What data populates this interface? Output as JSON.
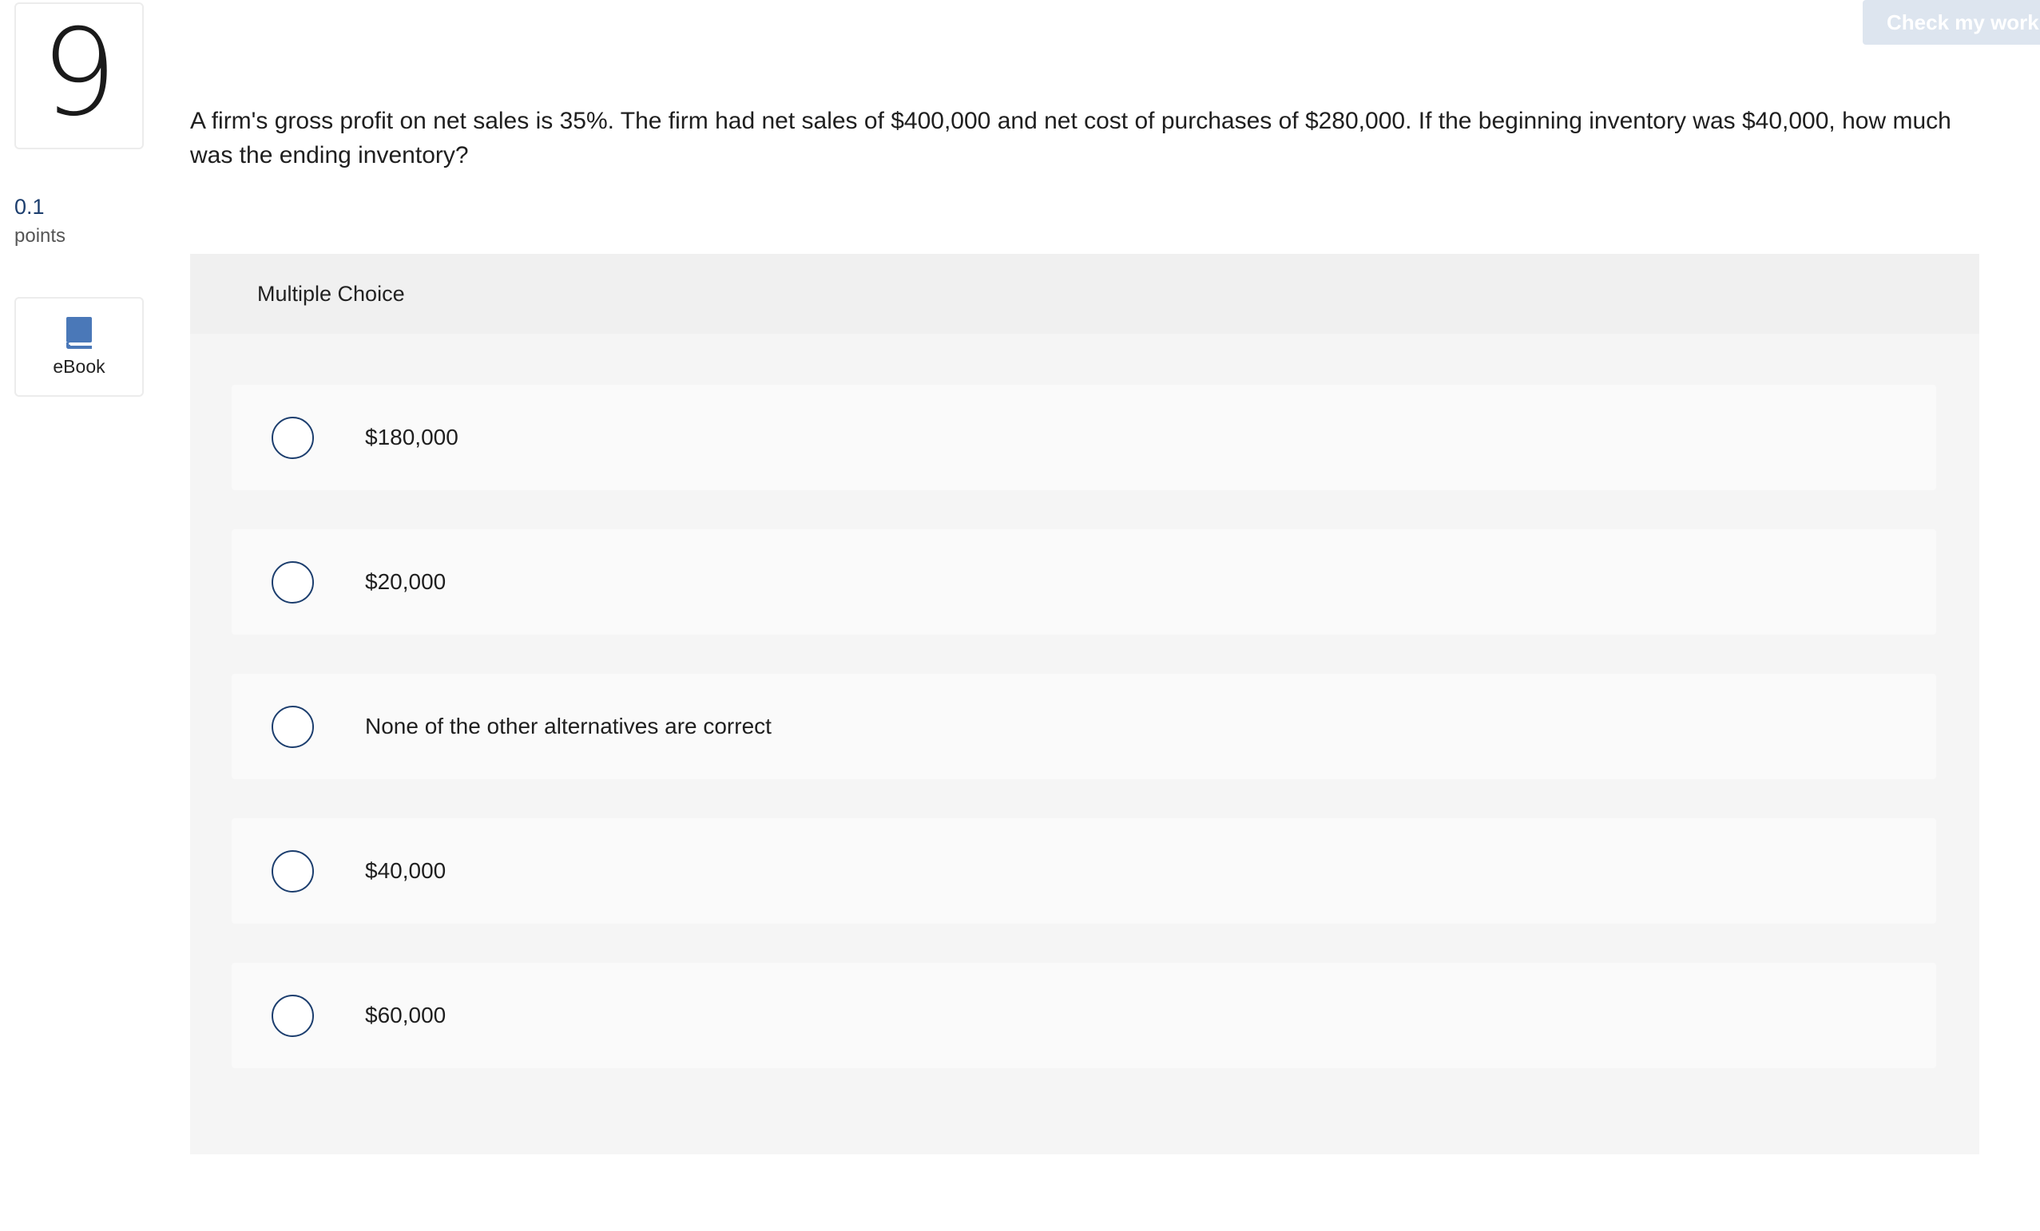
{
  "question_number": "9",
  "points": {
    "value": "0.1",
    "label": "points"
  },
  "ebook": {
    "label": "eBook",
    "icon": "book-icon"
  },
  "check_button": {
    "label": "Check my work"
  },
  "question_text": "A firm's gross profit on net sales is 35%. The firm had net sales of $400,000 and net cost of purchases of $280,000. If the beginning inventory was $40,000, how much was the ending inventory?",
  "answer_section": {
    "type_label": "Multiple Choice",
    "choices": [
      {
        "label": "$180,000",
        "selected": false
      },
      {
        "label": "$20,000",
        "selected": false
      },
      {
        "label": "None of the other alternatives are correct",
        "selected": false
      },
      {
        "label": "$40,000",
        "selected": false
      },
      {
        "label": "$60,000",
        "selected": false
      }
    ]
  },
  "colors": {
    "accent": "#1c3e6e",
    "ebook_icon": "#4a78b8",
    "button_disabled_bg": "#dde5ef",
    "panel_bg": "#f5f5f5"
  }
}
